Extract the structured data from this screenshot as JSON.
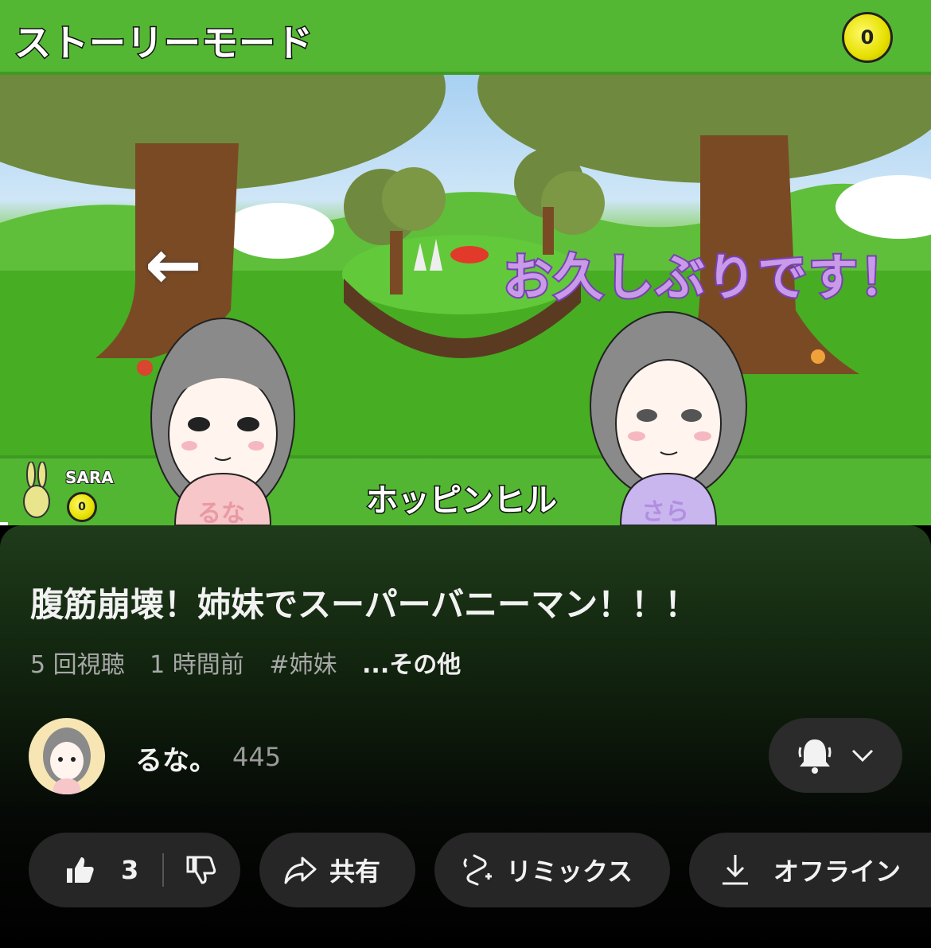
{
  "video": {
    "game_title": "ストーリーモード",
    "coin_mark": "0",
    "speech_text": "お久しぶりです！",
    "player_label": "SARA",
    "stage_name": "ホッピンヒル",
    "left_character_name": "るな",
    "right_character_name": "さら",
    "back_arrow": "←"
  },
  "info": {
    "title": "腹筋崩壊！姉妹でスーパーバニーマン！！！",
    "views": "5 回視聴",
    "time_ago": "1 時間前",
    "hashtag": "#姉妹",
    "more": "...その他"
  },
  "channel": {
    "name": "るな。",
    "subscribers": "445",
    "bell_icon": "bell-icon",
    "dropdown_icon": "chevron-down-icon"
  },
  "actions": {
    "like_count": "3",
    "share_label": "共有",
    "remix_label": "リミックス",
    "offline_label": "オフライン"
  },
  "colors": {
    "grass_green": "#54b734",
    "speech_purple": "#c99ae8",
    "panel_bg": "#1f3b1a",
    "pill_bg": "#262626"
  }
}
